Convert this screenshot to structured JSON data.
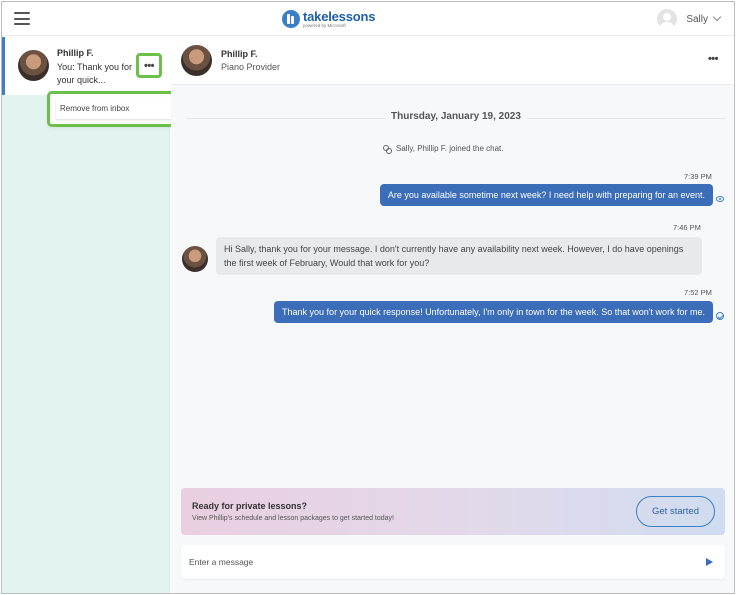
{
  "app": {
    "brand_name": "takelessons",
    "brand_sub": "powered by Microsoft",
    "user_name": "Sally"
  },
  "icons": [
    "menu-icon",
    "logo-icon",
    "user-avatar-icon",
    "chevron-down-icon",
    "more-icon",
    "seen-icon",
    "check-icon",
    "people-icon",
    "send-icon"
  ],
  "colors": {
    "accent": "#3b6db8",
    "highlight": "#6cc04a",
    "sidebar_bg": "#e3f3f0"
  },
  "sidebar": {
    "conversation": {
      "name": "Phillip F.",
      "snippet": "You: Thank you for your quick...",
      "more_label": "•••"
    },
    "context_menu": {
      "remove_label": "Remove from inbox"
    }
  },
  "chat": {
    "header": {
      "name": "Phillip F.",
      "role": "Piano Provider",
      "more_label": "•••"
    },
    "date": "Thursday, January 19, 2023",
    "joined_text": "Sally, Phillip F. joined the chat.",
    "messages": [
      {
        "time": "7:39 PM",
        "text": "Are you available sometime next week? I need help with preparing for an event."
      },
      {
        "time": "7:46 PM",
        "text": "Hi Sally, thank you for your message. I don't currently have any availability next week. However, I do have openings the first week of February, Would that work for you?"
      },
      {
        "time": "7:52 PM",
        "text": "Thank you for your quick response! Unfortunately, I'm only in town for the week. So that won't work for me."
      }
    ],
    "promo": {
      "title": "Ready for private lessons?",
      "subtitle": "View Phillip's schedule and lesson packages to get started today!",
      "button": "Get started"
    },
    "composer": {
      "placeholder": "Enter a message"
    }
  }
}
